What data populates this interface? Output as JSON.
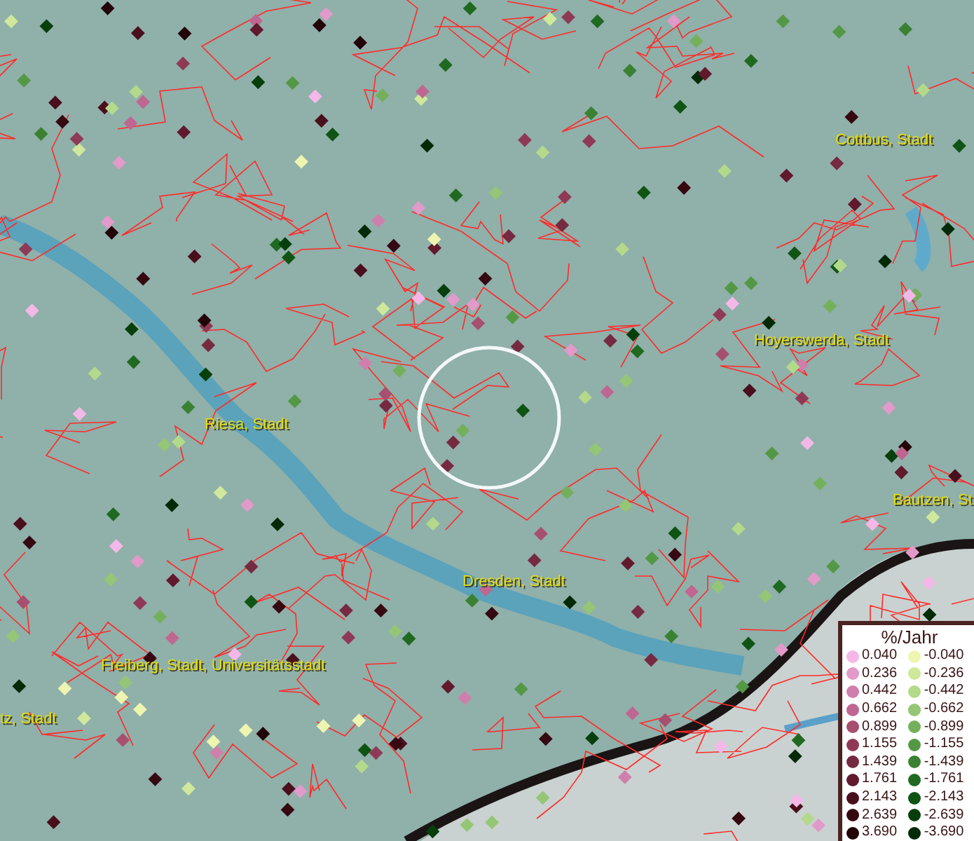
{
  "map": {
    "places": [
      {
        "name": "Cottbus, Stadt"
      },
      {
        "name": "Hoyerswerda, Stadt"
      },
      {
        "name": "Riesa, Stadt"
      },
      {
        "name": "Bautzen, St"
      },
      {
        "name": "Dresden, Stadt"
      },
      {
        "name": "Freiberg, Stadt, Universitätsstadt"
      },
      {
        "name": "tz, Stadt"
      }
    ]
  },
  "legend": {
    "title": "%/Jahr",
    "items": [
      {
        "value": "0.040",
        "color": "#f4b8e8"
      },
      {
        "value": "-0.040",
        "color": "#eef5b0"
      },
      {
        "value": "0.236",
        "color": "#e19ac9"
      },
      {
        "value": "-0.236",
        "color": "#cfe89c"
      },
      {
        "value": "0.442",
        "color": "#cf7fab"
      },
      {
        "value": "-0.442",
        "color": "#b3d98a"
      },
      {
        "value": "0.662",
        "color": "#bf6790"
      },
      {
        "value": "-0.662",
        "color": "#94c675"
      },
      {
        "value": "0.899",
        "color": "#a64f6f"
      },
      {
        "value": "-0.899",
        "color": "#74b05c"
      },
      {
        "value": "1.155",
        "color": "#8e3a56"
      },
      {
        "value": "-1.155",
        "color": "#549846"
      },
      {
        "value": "1.439",
        "color": "#762a41"
      },
      {
        "value": "-1.439",
        "color": "#3a8232"
      },
      {
        "value": "1.761",
        "color": "#61192c"
      },
      {
        "value": "-1.761",
        "color": "#1f6a20"
      },
      {
        "value": "2.143",
        "color": "#4a0f1c"
      },
      {
        "value": "-2.143",
        "color": "#105414"
      },
      {
        "value": "2.639",
        "color": "#350812"
      },
      {
        "value": "-2.639",
        "color": "#073f0c"
      },
      {
        "value": "3.690",
        "color": "#220308"
      },
      {
        "value": "-3.690",
        "color": "#032a06"
      }
    ]
  }
}
